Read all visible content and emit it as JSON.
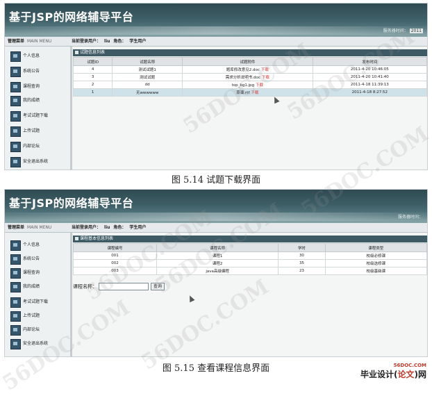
{
  "screen1": {
    "banner_title": "基于JSP的网络辅导平台",
    "clock_label": "服务器时间：",
    "clock_value": "2011",
    "menu_title": "管理菜单",
    "menu_title_en": "MAIN MENU",
    "login_user_label": "当前登录用户：",
    "login_user": "liu",
    "role_label": "角色：",
    "role": "学生用户",
    "sidebar": [
      "个人信息",
      "系统公告",
      "课程查询",
      "我的成绩",
      "考试试题下载",
      "上传试题",
      "内部论坛",
      "安全退出系统"
    ],
    "panel_title": "试题信息列表",
    "columns": [
      "试题ID",
      "试题名称",
      "试题附件",
      "发布时间"
    ],
    "rows": [
      {
        "id": "4",
        "name": "测试试题1",
        "file": "题库修改意见2.doc",
        "dl": "下载",
        "time": "2011-4-20 10:46:05"
      },
      {
        "id": "3",
        "name": "测试试题",
        "file": "需求分析说明书.doc",
        "dl": "下载",
        "time": "2011-4-20 10:41:40"
      },
      {
        "id": "2",
        "name": "dd",
        "file": "top_bg1.jpg",
        "dl": "下载",
        "time": "2011-4-18 11:39:13"
      },
      {
        "id": "1",
        "name": "无wwwwww",
        "file": "菜谱.rtf",
        "dl": "下载",
        "time": "2011-4-18 8:27:52"
      }
    ]
  },
  "caption1": "图 5.14 试题下载界面",
  "screen2": {
    "banner_title": "基于JSP的网络辅导平台",
    "clock_label": "服务器时间：",
    "menu_title": "管理菜单",
    "menu_title_en": "MAIN MENU",
    "login_user_label": "当前登录用户：",
    "login_user": "liu",
    "role_label": "角色：",
    "role": "学生用户",
    "sidebar": [
      "个人信息",
      "系统公告",
      "课程查询",
      "我的成绩",
      "考试试题下载",
      "上传试题",
      "内部论坛",
      "安全退出系统"
    ],
    "panel_title": "课程基本信息列表",
    "columns": [
      "课程编号",
      "课程名称",
      "学时",
      "课程类型"
    ],
    "rows": [
      {
        "code": "001",
        "name": "课程1",
        "hours": "30",
        "type": "校级必修课"
      },
      {
        "code": "002",
        "name": "课程2",
        "hours": "35",
        "type": "校级选修课"
      },
      {
        "code": "003",
        "name": "java高级编程",
        "hours": "23",
        "type": "校级基础课"
      }
    ],
    "search_label": "课程名称：",
    "search_button": "查询"
  },
  "caption2": "图 5.15 查看课程信息界面",
  "watermark": "56DOC.COM",
  "logo": {
    "site": "56DOC.COM",
    "name_a": "毕业设计(",
    "name_b": "论文",
    "name_c": ")网"
  }
}
